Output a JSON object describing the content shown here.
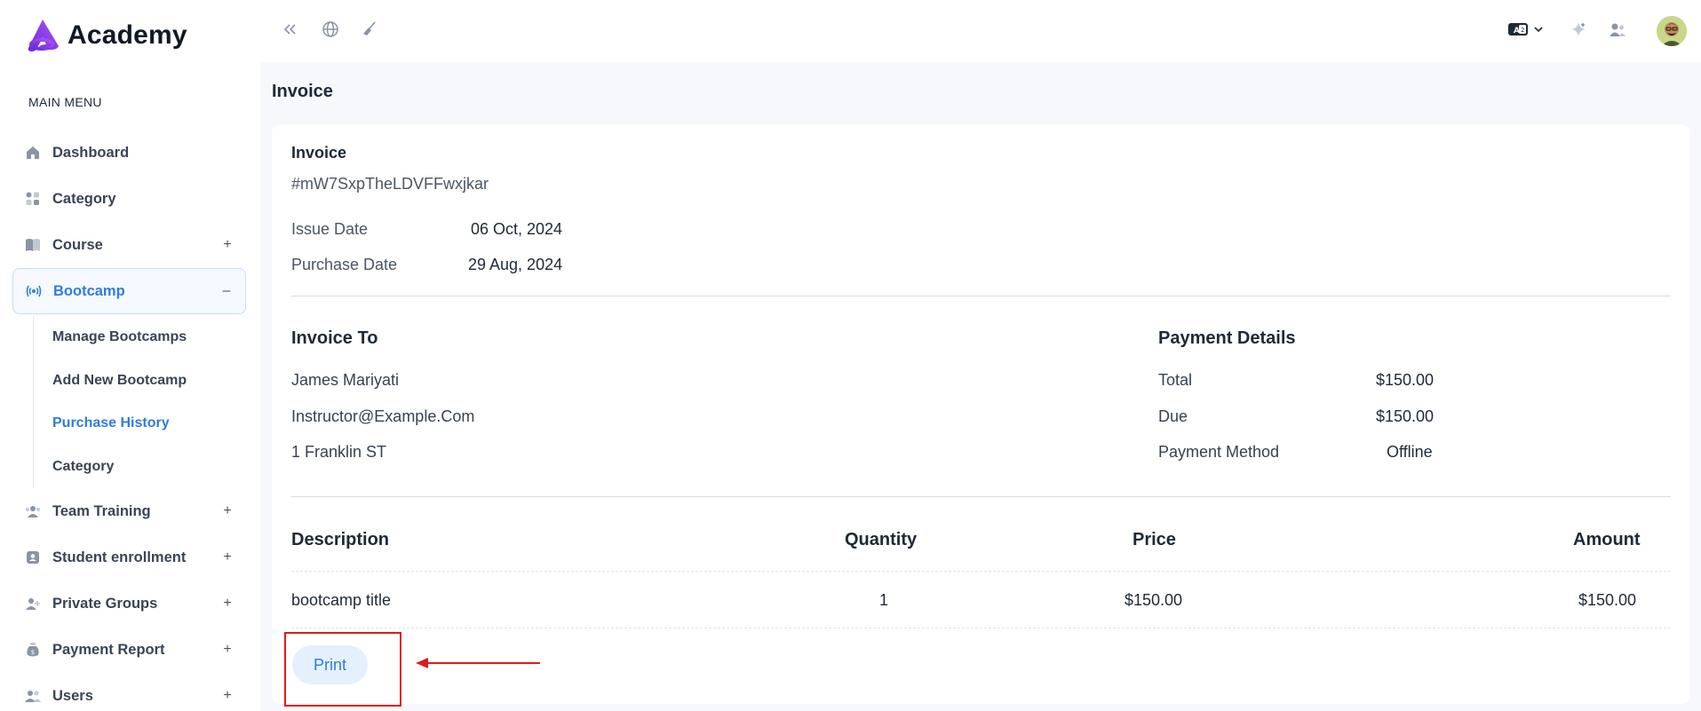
{
  "app": {
    "name": "Academy"
  },
  "sidebar": {
    "menu_heading": "MAIN MENU",
    "items": [
      {
        "label": "Dashboard",
        "icon": "home-icon",
        "toggle": ""
      },
      {
        "label": "Category",
        "icon": "grid-icon",
        "toggle": ""
      },
      {
        "label": "Course",
        "icon": "book-icon",
        "toggle": "+"
      },
      {
        "label": "Bootcamp",
        "icon": "broadcast-icon",
        "toggle": "–"
      },
      {
        "label": "Team Training",
        "icon": "team-icon",
        "toggle": "+"
      },
      {
        "label": "Student enrollment",
        "icon": "enrollment-icon",
        "toggle": "+"
      },
      {
        "label": "Private Groups",
        "icon": "group-icon",
        "toggle": "+"
      },
      {
        "label": "Payment Report",
        "icon": "money-bag-icon",
        "toggle": "+"
      },
      {
        "label": "Users",
        "icon": "users-icon",
        "toggle": "+"
      }
    ],
    "bootcamp_sub": [
      {
        "label": "Manage Bootcamps"
      },
      {
        "label": "Add New Bootcamp"
      },
      {
        "label": "Purchase History"
      },
      {
        "label": "Category"
      }
    ],
    "active_item": "Bootcamp",
    "active_sub": "Purchase History"
  },
  "topbar": {
    "icons": [
      "collapse-icon",
      "globe-icon",
      "broom-icon",
      "language-icon",
      "chevron-down-icon",
      "sparkle-icon",
      "user-switch-icon",
      "avatar"
    ]
  },
  "page": {
    "title": "Invoice"
  },
  "invoice": {
    "heading": "Invoice",
    "id": "#mW7SxpTheLDVFFwxjkar",
    "issue_date_label": "Issue Date",
    "issue_date": "06 Oct, 2024",
    "purchase_date_label": "Purchase Date",
    "purchase_date": "29 Aug, 2024",
    "invoice_to": {
      "heading": "Invoice To",
      "name": "James Mariyati",
      "email": "Instructor@Example.Com",
      "address": "1 Franklin ST"
    },
    "payment_details": {
      "heading": "Payment Details",
      "total_label": "Total",
      "total": "$150.00",
      "due_label": "Due",
      "due": "$150.00",
      "method_label": "Payment Method",
      "method": "Offline"
    },
    "table": {
      "headers": {
        "description": "Description",
        "quantity": "Quantity",
        "price": "Price",
        "amount": "Amount"
      },
      "rows": [
        {
          "description": "bootcamp title",
          "quantity": "1",
          "price": "$150.00",
          "amount": "$150.00"
        }
      ]
    },
    "print_label": "Print"
  },
  "colors": {
    "accent": "#2f7ce0",
    "brand": "#7c3aed",
    "annotation": "#e01b1b"
  }
}
